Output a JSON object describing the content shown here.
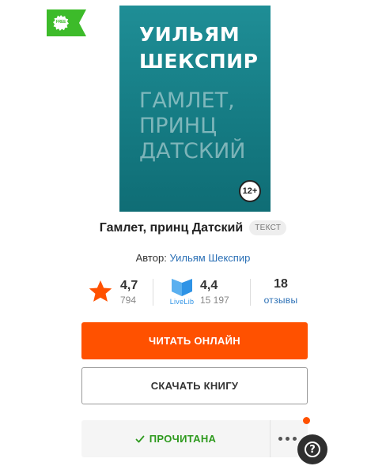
{
  "badge": {
    "free_label": "FREE"
  },
  "cover": {
    "author_line1": "УИЛЬЯМ",
    "author_line2": "ШЕКСПИР",
    "title_line1": "ГАМЛЕТ,",
    "title_line2": "ПРИНЦ",
    "title_line3": "ДАТСКИЙ",
    "age_rating": "12+",
    "colors": {
      "top": "#1f8e96",
      "bottom": "#0f6d75"
    }
  },
  "book": {
    "title": "Гамлет, принц Датский",
    "type_badge": "ТЕКСТ",
    "author_prefix": "Автор:",
    "author_name": "Уильям Шекспир"
  },
  "ratings": {
    "litres": {
      "icon": "star-icon",
      "value": "4,7",
      "count": "794"
    },
    "livelib": {
      "icon": "livelib-logo",
      "logo_text": "LiveLib",
      "value": "4,4",
      "count": "15 197"
    },
    "reviews": {
      "count": "18",
      "label": "отзывы"
    }
  },
  "actions": {
    "read_online": "ЧИТАТЬ ОНЛАЙН",
    "download": "СКАЧАТЬ КНИГУ",
    "read_status": "ПРОЧИТАНА",
    "more_icon": "more-dots-icon",
    "help_icon": "help-icon"
  },
  "colors": {
    "accent": "#ff5100",
    "status_green": "#2e9a1e",
    "link_blue": "#2a6fb5",
    "free_green": "#3dbb2a"
  }
}
